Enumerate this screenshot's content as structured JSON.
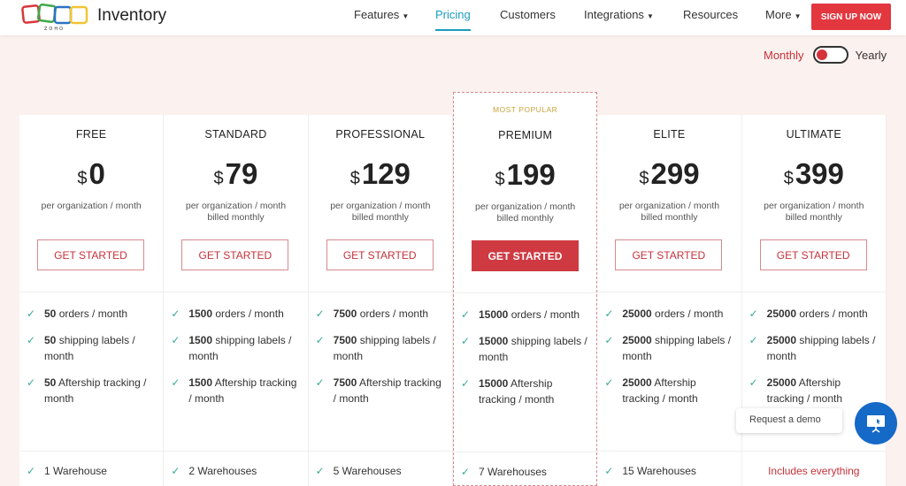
{
  "header": {
    "brand": "Inventory",
    "logo_text": "ZOHO",
    "nav": [
      {
        "label": "Features",
        "caret": true
      },
      {
        "label": "Pricing",
        "active": true
      },
      {
        "label": "Customers"
      },
      {
        "label": "Integrations",
        "caret": true
      },
      {
        "label": "Resources"
      },
      {
        "label": "More",
        "caret": true
      }
    ],
    "signup": "SIGN UP NOW"
  },
  "billing": {
    "monthly": "Monthly",
    "yearly": "Yearly",
    "selected": "Monthly"
  },
  "colors": {
    "accent": "#cf3a42",
    "link": "#1a9bbd",
    "check": "#3aaa9a",
    "fab": "#1569c7"
  },
  "plans": [
    {
      "name": "FREE",
      "currency": "$",
      "price": "0",
      "per": "per organization / month",
      "billed": "",
      "cta": "GET STARTED",
      "features": [
        [
          "50",
          "orders / month"
        ],
        [
          "50",
          "shipping labels / month"
        ],
        [
          "50",
          "Aftership tracking / month"
        ]
      ],
      "next": "1 Warehouse"
    },
    {
      "name": "STANDARD",
      "currency": "$",
      "price": "79",
      "per": "per organization / month",
      "billed": "billed monthly",
      "cta": "GET STARTED",
      "features": [
        [
          "1500",
          "orders / month"
        ],
        [
          "1500",
          "shipping labels / month"
        ],
        [
          "1500",
          "Aftership tracking / month"
        ]
      ],
      "next": "2 Warehouses"
    },
    {
      "name": "PROFESSIONAL",
      "currency": "$",
      "price": "129",
      "per": "per organization / month",
      "billed": "billed monthly",
      "cta": "GET STARTED",
      "features": [
        [
          "7500",
          "orders / month"
        ],
        [
          "7500",
          "shipping labels / month"
        ],
        [
          "7500",
          "Aftership tracking / month"
        ]
      ],
      "next": "5 Warehouses"
    },
    {
      "name": "PREMIUM",
      "badge": "MOST POPULAR",
      "currency": "$",
      "price": "199",
      "per": "per organization / month",
      "billed": "billed monthly",
      "cta": "GET STARTED",
      "features": [
        [
          "15000",
          "orders / month"
        ],
        [
          "15000",
          "shipping labels / month"
        ],
        [
          "15000",
          "Aftership tracking / month"
        ]
      ],
      "next": "7 Warehouses"
    },
    {
      "name": "ELITE",
      "currency": "$",
      "price": "299",
      "per": "per organization / month",
      "billed": "billed monthly",
      "cta": "GET STARTED",
      "features": [
        [
          "25000",
          "orders / month"
        ],
        [
          "25000",
          "shipping labels / month"
        ],
        [
          "25000",
          "Aftership tracking / month"
        ]
      ],
      "next": "15 Warehouses"
    },
    {
      "name": "ULTIMATE",
      "currency": "$",
      "price": "399",
      "per": "per organization / month",
      "billed": "billed monthly",
      "cta": "GET STARTED",
      "features": [
        [
          "25000",
          "orders / month"
        ],
        [
          "25000",
          "shipping labels / month"
        ],
        [
          "25000",
          "Aftership tracking / month"
        ]
      ],
      "next": "Includes everything",
      "next_highlight": true
    }
  ],
  "demo": {
    "label": "Request a demo",
    "icon": "presentation-icon"
  }
}
